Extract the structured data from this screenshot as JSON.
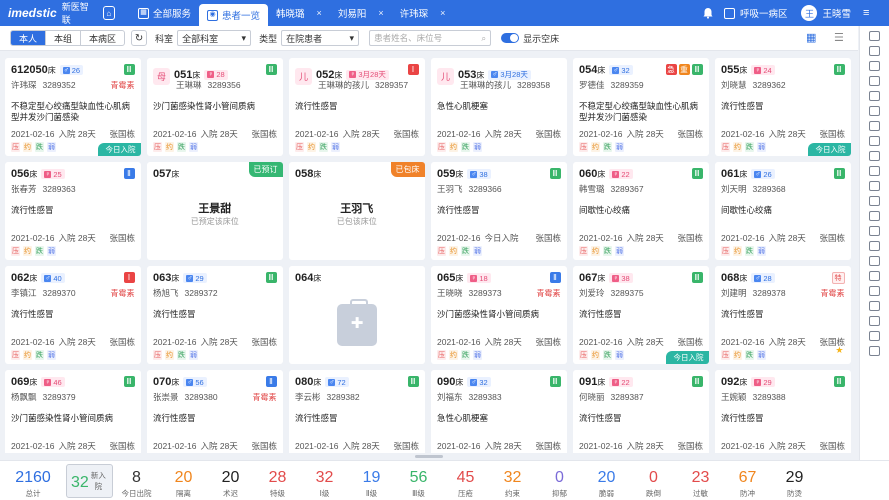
{
  "header": {
    "brand": "imedstic",
    "brand_sub": "新医智联",
    "tabs": [
      {
        "label": "全部服务",
        "close": ""
      },
      {
        "label": "患者一览",
        "close": ""
      },
      {
        "label": "韩晓璐",
        "close": "×"
      },
      {
        "label": "刘易阳",
        "close": "×"
      },
      {
        "label": "许玮琛",
        "close": "×"
      }
    ],
    "ward": "呼吸一病区",
    "user": "王晓雪",
    "avatar": "王"
  },
  "filters": {
    "scope": [
      "本人",
      "本组",
      "本病区"
    ],
    "dept_label": "科室",
    "dept_value": "全部科室",
    "type_label": "类型",
    "type_value": "在院患者",
    "search_placeholder": "患者姓名、床位号",
    "toggle_label": "显示空床"
  },
  "cards": [
    {
      "bed": "612050",
      "unit": "床",
      "sex": "m",
      "age": "26",
      "name": "许玮琛",
      "id": "3289352",
      "tag": "青霉素",
      "badge": "Ⅲ",
      "bc": "g",
      "diag": "不稳定型心绞痛型缺血性心肌病型并发沙门菌感染",
      "date": "2021-02-16",
      "days": "入院 28天",
      "doc": "张国栋",
      "today": "今日入院",
      "marks": [
        "压",
        "约",
        "跌",
        "弱"
      ]
    },
    {
      "bed": "051",
      "unit": "床",
      "sex": "f",
      "age": "28",
      "name": "王琳琳",
      "id": "3289356",
      "avatar": "母",
      "badge": "Ⅲ",
      "bc": "g",
      "diag": "沙门菌感染性肾小管间质病",
      "date": "2021-02-16",
      "days": "入院 28天",
      "doc": "张国栋",
      "marks": [
        "压",
        "约",
        "跌",
        "弱"
      ]
    },
    {
      "bed": "052",
      "unit": "床",
      "sex": "f",
      "age": "3月28天",
      "name": "王琳琳的孩儿",
      "id": "3289357",
      "avatar": "儿",
      "badge": "Ⅰ",
      "bc": "r",
      "diag": "流行性感冒",
      "date": "2021-02-16",
      "days": "入院 28天",
      "doc": "张国栋",
      "marks": [
        "压",
        "约",
        "跌",
        "弱"
      ]
    },
    {
      "bed": "053",
      "unit": "床",
      "sex": "m",
      "age": "3月28天",
      "name": "王琳琳的孩儿",
      "id": "3289358",
      "avatar": "儿",
      "diag": "急性心肌梗塞",
      "date": "2021-02-16",
      "days": "入院 28天",
      "doc": "张国栋",
      "marks": [
        "压",
        "约",
        "跌",
        "弱"
      ]
    },
    {
      "bed": "054",
      "unit": "床",
      "sex": "m",
      "age": "32",
      "name": "罗德佳",
      "id": "3289359",
      "badges": [
        {
          "t": "急",
          "c": "r"
        },
        {
          "t": "重",
          "c": "o"
        },
        {
          "t": "Ⅲ",
          "c": "g"
        }
      ],
      "diag": "不稳定型心绞痛型缺血性心肌病型并发沙门菌感染",
      "date": "2021-02-16",
      "days": "入院 28天",
      "doc": "张国栋",
      "marks": [
        "压",
        "约",
        "跌",
        "弱"
      ]
    },
    {
      "bed": "055",
      "unit": "床",
      "sex": "f",
      "age": "24",
      "name": "刘晓慧",
      "id": "3289362",
      "badge": "Ⅲ",
      "bc": "g",
      "diag": "流行性感冒",
      "date": "2021-02-16",
      "days": "入院 28天",
      "doc": "张国栋",
      "today": "今日入院",
      "marks": [
        "压",
        "约",
        "跌",
        "弱"
      ]
    },
    {
      "bed": "056",
      "unit": "床",
      "sex": "f",
      "age": "25",
      "name": "张春芳",
      "id": "3289363",
      "badge": "Ⅱ",
      "bc": "b",
      "diag": "流行性感冒",
      "date": "2021-02-16",
      "days": "入院 28天",
      "doc": "张国栋",
      "marks": [
        "压",
        "约",
        "跌",
        "弱"
      ]
    },
    {
      "bed": "057",
      "unit": "床",
      "reserved": "已预订",
      "cname": "王景甜",
      "cnote": "已预定该床位"
    },
    {
      "bed": "058",
      "unit": "床",
      "packed": "已包床",
      "cname": "王羽飞",
      "cnote": "已包该床位"
    },
    {
      "bed": "059",
      "unit": "床",
      "sex": "m",
      "age": "38",
      "name": "王羽飞",
      "id": "3289366",
      "badge": "Ⅲ",
      "bc": "g",
      "diag": "流行性感冒",
      "date": "2021-02-16",
      "days": "今日入院",
      "doc": "张国栋",
      "marks": [
        "压",
        "约",
        "跌",
        "弱"
      ]
    },
    {
      "bed": "060",
      "unit": "床",
      "sex": "f",
      "age": "22",
      "name": "韩雪璐",
      "id": "3289367",
      "badge": "Ⅲ",
      "bc": "g",
      "diag": "间歇性心绞痛",
      "date": "2021-02-16",
      "days": "入院 28天",
      "doc": "张国栋",
      "marks": [
        "压",
        "约",
        "跌",
        "弱"
      ]
    },
    {
      "bed": "061",
      "unit": "床",
      "sex": "m",
      "age": "26",
      "name": "刘天明",
      "id": "3289368",
      "badge": "Ⅲ",
      "bc": "g",
      "diag": "间歇性心绞痛",
      "date": "2021-02-16",
      "days": "入院 28天",
      "doc": "张国栋",
      "marks": [
        "压",
        "约",
        "跌",
        "弱"
      ]
    },
    {
      "bed": "062",
      "unit": "床",
      "sex": "m",
      "age": "40",
      "name": "李镇江",
      "id": "3289370",
      "tag": "青霉素",
      "badge": "Ⅰ",
      "bc": "r",
      "diag": "流行性感冒",
      "date": "2021-02-16",
      "days": "入院 28天",
      "doc": "张国栋",
      "marks": [
        "压",
        "约",
        "跌",
        "弱"
      ]
    },
    {
      "bed": "063",
      "unit": "床",
      "sex": "m",
      "age": "29",
      "name": "杨旭飞",
      "id": "3289372",
      "badge": "Ⅲ",
      "bc": "g",
      "diag": "流行性感冒",
      "date": "2021-02-16",
      "days": "入院 28天",
      "doc": "张国栋",
      "marks": [
        "压",
        "约",
        "跌",
        "弱"
      ]
    },
    {
      "bed": "064",
      "unit": "床",
      "empty": true
    },
    {
      "bed": "065",
      "unit": "床",
      "sex": "f",
      "age": "18",
      "name": "王晓晓",
      "id": "3289373",
      "tag": "青霉素",
      "badge": "Ⅱ",
      "bc": "b",
      "diag": "沙门菌感染性肾小管间质病",
      "date": "2021-02-16",
      "days": "入院 28天",
      "doc": "张国栋",
      "marks": [
        "压",
        "约",
        "跌",
        "弱"
      ]
    },
    {
      "bed": "067",
      "unit": "床",
      "sex": "f",
      "age": "38",
      "name": "刘爱玲",
      "id": "3289375",
      "badge": "Ⅲ",
      "bc": "g",
      "diag": "流行性感冒",
      "date": "2021-02-16",
      "days": "入院 28天",
      "doc": "张国栋",
      "today": "今日入院",
      "marks": [
        "压",
        "约",
        "跌",
        "弱"
      ]
    },
    {
      "bed": "068",
      "unit": "床",
      "sex": "m",
      "age": "28",
      "name": "刘建明",
      "id": "3289378",
      "tag": "青霉素",
      "special": "特",
      "diag": "流行性感冒",
      "date": "2021-02-16",
      "days": "入院 28天",
      "doc": "张国栋",
      "star": "★",
      "marks": [
        "压",
        "约",
        "跌",
        "弱"
      ]
    },
    {
      "bed": "069",
      "unit": "床",
      "sex": "f",
      "age": "46",
      "name": "杨飘飘",
      "id": "3289379",
      "badge": "Ⅲ",
      "bc": "g",
      "diag": "沙门菌感染性肾小管间质病",
      "date": "2021-02-16",
      "days": "入院 28天",
      "doc": "张国栋",
      "marks": [
        "压",
        "约",
        "跌",
        "弱"
      ]
    },
    {
      "bed": "070",
      "unit": "床",
      "sex": "m",
      "age": "56",
      "name": "张崇景",
      "id": "3289380",
      "tag": "青霉素",
      "badge": "Ⅱ",
      "bc": "b",
      "diag": "流行性感冒",
      "date": "2021-02-16",
      "days": "入院 28天",
      "doc": "张国栋",
      "marks": [
        "压",
        "约",
        "跌",
        "弱"
      ]
    },
    {
      "bed": "080",
      "unit": "床",
      "sex": "m",
      "age": "72",
      "name": "李云彬",
      "id": "3289382",
      "badge": "Ⅲ",
      "bc": "g",
      "diag": "流行性感冒",
      "date": "2021-02-16",
      "days": "入院 28天",
      "doc": "张国栋",
      "marks": [
        "压",
        "约",
        "跌",
        "弱"
      ]
    },
    {
      "bed": "090",
      "unit": "床",
      "sex": "m",
      "age": "32",
      "name": "刘福东",
      "id": "3289383",
      "badge": "Ⅲ",
      "bc": "g",
      "diag": "急性心肌梗塞",
      "date": "2021-02-16",
      "days": "入院 28天",
      "doc": "张国栋",
      "marks": [
        "压",
        "约",
        "跌",
        "弱"
      ]
    },
    {
      "bed": "091",
      "unit": "床",
      "sex": "f",
      "age": "22",
      "name": "何晓丽",
      "id": "3289387",
      "badge": "Ⅲ",
      "bc": "g",
      "diag": "流行性感冒",
      "date": "2021-02-16",
      "days": "入院 28天",
      "doc": "张国栋",
      "marks": [
        "压",
        "约",
        "跌",
        "弱"
      ]
    },
    {
      "bed": "092",
      "unit": "床",
      "sex": "f",
      "age": "29",
      "name": "王婉颖",
      "id": "3289388",
      "badge": "Ⅲ",
      "bc": "g",
      "diag": "流行性感冒",
      "date": "2021-02-16",
      "days": "入院 28天",
      "doc": "张国栋",
      "marks": [
        "压",
        "约",
        "跌",
        "弱"
      ]
    }
  ],
  "stats": [
    {
      "n": "2160",
      "l": "总计",
      "c": "#2f6fe0"
    },
    {
      "n": "32",
      "l": "新入院",
      "c": "#39b56a"
    },
    {
      "n": "8",
      "l": "今日出院",
      "c": "#333"
    },
    {
      "n": "20",
      "l": "隔离",
      "c": "#f0861e"
    },
    {
      "n": "20",
      "l": "术迟",
      "c": "#222"
    },
    {
      "n": "28",
      "l": "特级",
      "c": "#e24b4b"
    },
    {
      "n": "32",
      "l": "Ⅰ级",
      "c": "#e24b4b"
    },
    {
      "n": "19",
      "l": "Ⅱ级",
      "c": "#3a7be8"
    },
    {
      "n": "56",
      "l": "Ⅲ级",
      "c": "#39b56a"
    },
    {
      "n": "45",
      "l": "压疮",
      "c": "#e24b4b"
    },
    {
      "n": "32",
      "l": "约束",
      "c": "#f0861e"
    },
    {
      "n": "0",
      "l": "抑郁",
      "c": "#7b6bd8"
    },
    {
      "n": "20",
      "l": "脆弱",
      "c": "#3a7be8"
    },
    {
      "n": "0",
      "l": "跌倒",
      "c": "#e24b4b"
    },
    {
      "n": "23",
      "l": "过敏",
      "c": "#e24b4b"
    },
    {
      "n": "67",
      "l": "防冲",
      "c": "#f0861e"
    },
    {
      "n": "29",
      "l": "防烫",
      "c": "#222"
    }
  ]
}
